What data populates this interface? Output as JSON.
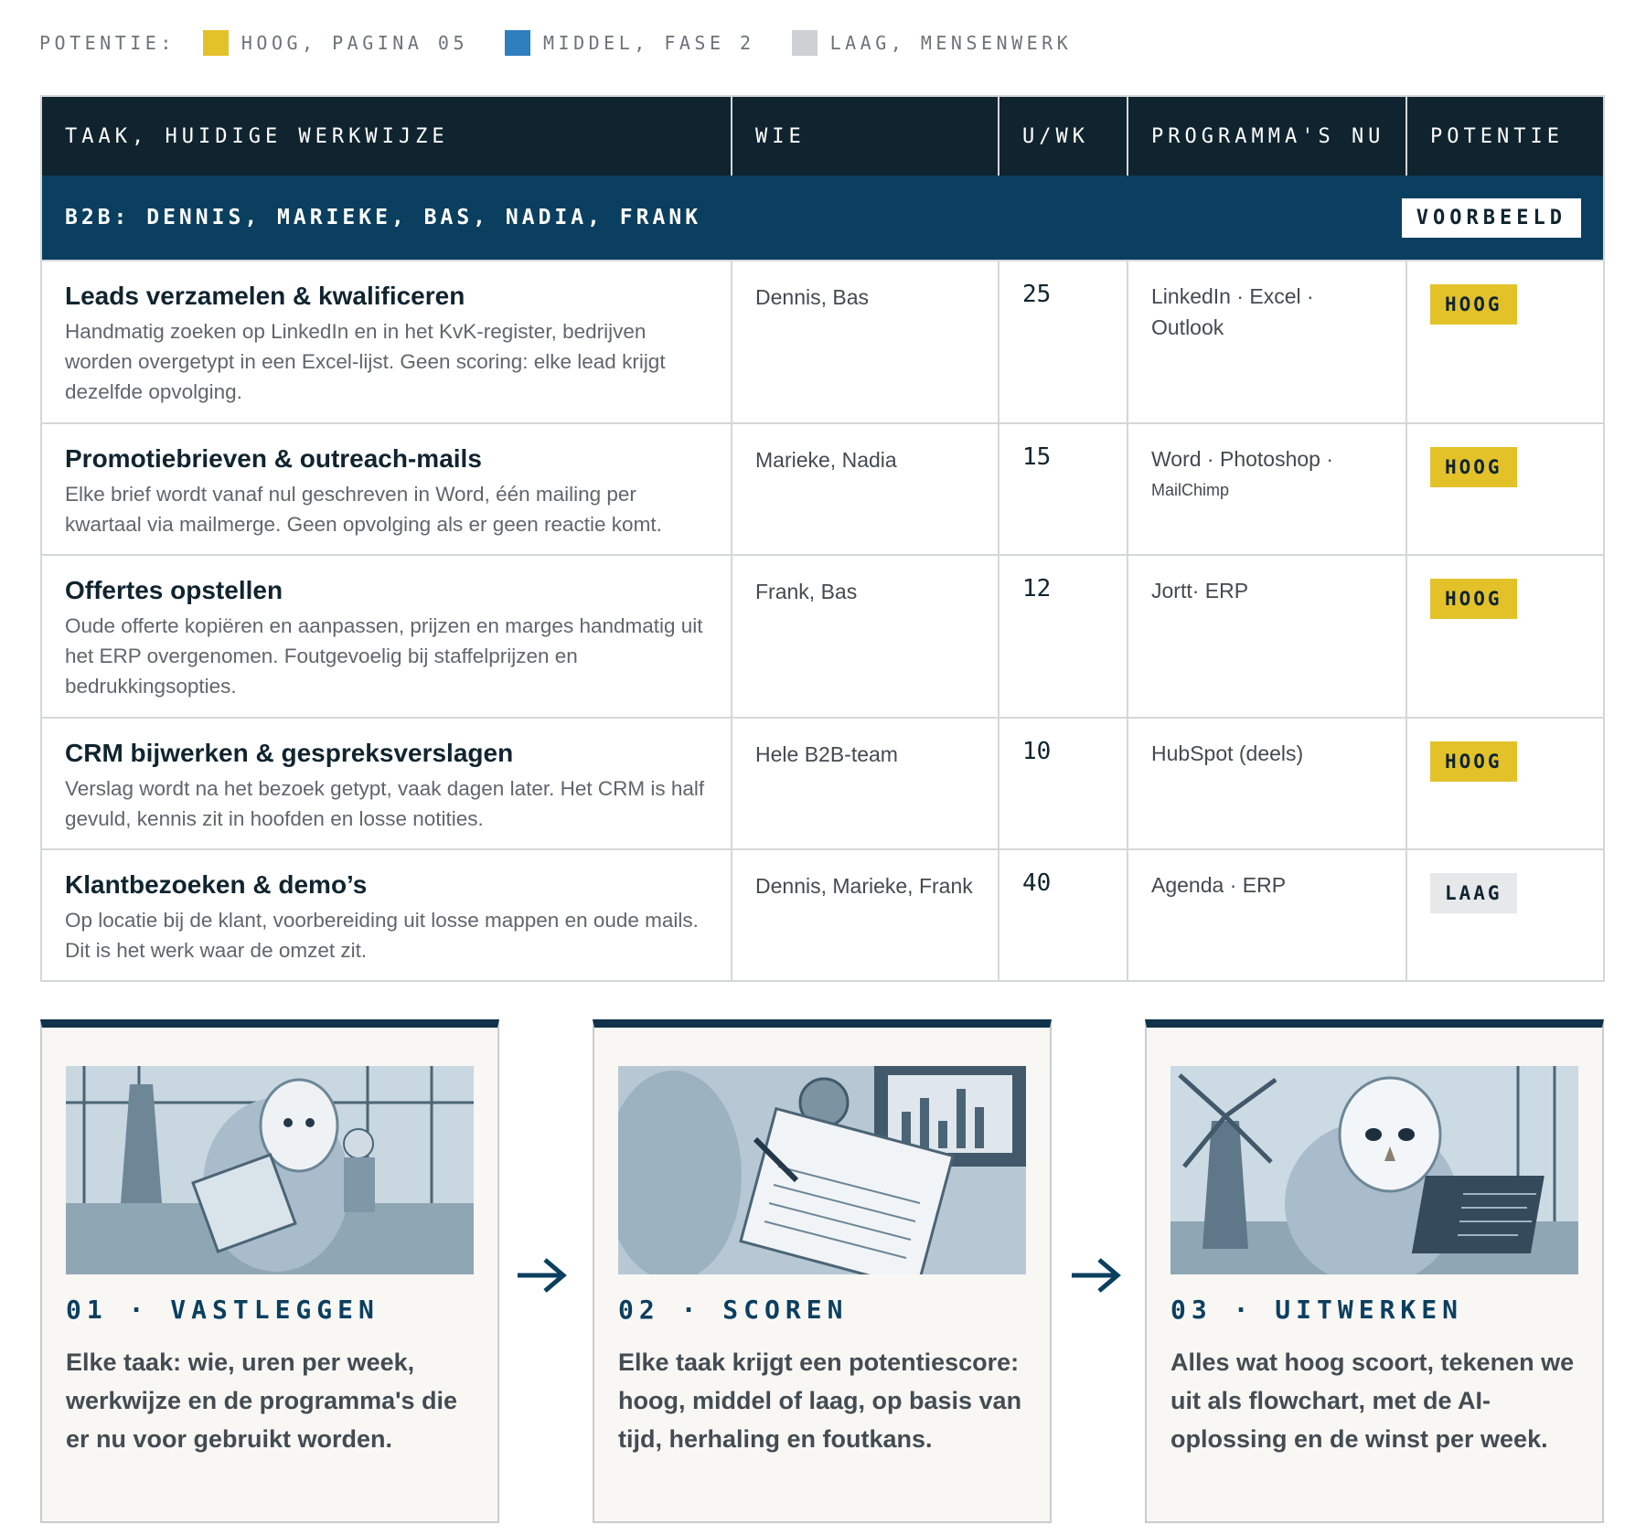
{
  "legend": {
    "label": "POTENTIE:",
    "items": [
      {
        "text": "HOOG, PAGINA 05",
        "color": "#e3c229"
      },
      {
        "text": "MIDDEL, FASE 2",
        "color": "#2f7fbf"
      },
      {
        "text": "LAAG, MENSENWERK",
        "color": "#cdd1d4"
      }
    ]
  },
  "table": {
    "headers": [
      "TAAK, HUIDIGE WERKWIJZE",
      "WIE",
      "U/WK",
      "PROGRAMMA'S NU",
      "POTENTIE"
    ],
    "group": {
      "title": "B2B: DENNIS, MARIEKE, BAS, NADIA, FRANK",
      "badge": "VOORBEELD"
    },
    "rows": [
      {
        "title": "Leads verzamelen & kwalificeren",
        "desc": "Handmatig zoeken op LinkedIn en in het KvK-register, bedrijven worden overgetypt in een Excel-lijst. Geen scoring: elke lead krijgt dezelfde opvolging.",
        "who": "Dennis, Bas",
        "hours": "25",
        "programs": "LinkedIn · Excel · Outlook",
        "programs_small": "",
        "potential": "HOOG"
      },
      {
        "title": "Promotiebrieven & outreach-mails",
        "desc": "Elke brief wordt vanaf nul geschreven in Word, één mailing per kwartaal via mailmerge. Geen opvolging als er geen reactie komt.",
        "who": "Marieke, Nadia",
        "hours": "15",
        "programs": "Word · Photoshop ·",
        "programs_small": "MailChimp",
        "potential": "HOOG"
      },
      {
        "title": "Offertes opstellen",
        "desc": "Oude offerte kopiëren en aanpassen, prijzen en marges handmatig uit het ERP overgenomen. Foutgevoelig bij staffelprijzen en bedrukkingsopties.",
        "who": "Frank, Bas",
        "hours": "12",
        "programs": "Jortt· ERP",
        "programs_small": "",
        "potential": "HOOG"
      },
      {
        "title": "CRM bijwerken & gespreksverslagen",
        "desc": "Verslag wordt na het bezoek getypt, vaak dagen later. Het CRM is half gevuld, kennis zit in hoofden en losse notities.",
        "who": "Hele B2B-team",
        "hours": "10",
        "programs": "HubSpot (deels)",
        "programs_small": "",
        "potential": "HOOG"
      },
      {
        "title": "Klantbezoeken & demo’s",
        "desc": "Op locatie bij de klant, voorbereiding uit losse mappen en oude mails. Dit is het werk waar de omzet zit.",
        "who": "Dennis, Marieke, Frank",
        "hours": "40",
        "programs": "Agenda · ERP",
        "programs_small": "",
        "potential": "LAAG"
      }
    ]
  },
  "potential_colors": {
    "HOOG": "#e3c229",
    "LAAG": "#e6e8ea"
  },
  "steps": [
    {
      "num": "01 · VASTLEGGEN",
      "text": "Elke taak: wie, uren per week, werkwijze en de programma's die er nu voor gebruikt worden.",
      "image": "owl-with-clipboard-in-factory-illustration"
    },
    {
      "num": "02 · SCOREN",
      "text": "Elke taak krijgt een potentiescore: hoog, middel of laag, op basis van tijd, herhaling en foutkans.",
      "image": "owl-writing-on-score-sheet-illustration"
    },
    {
      "num": "03 · UITWERKEN",
      "text": "Alles wat hoog scoort, tekenen we uit als flowchart, met de AI-oplossing en de winst per week.",
      "image": "owl-with-laptop-and-windmill-illustration"
    }
  ]
}
